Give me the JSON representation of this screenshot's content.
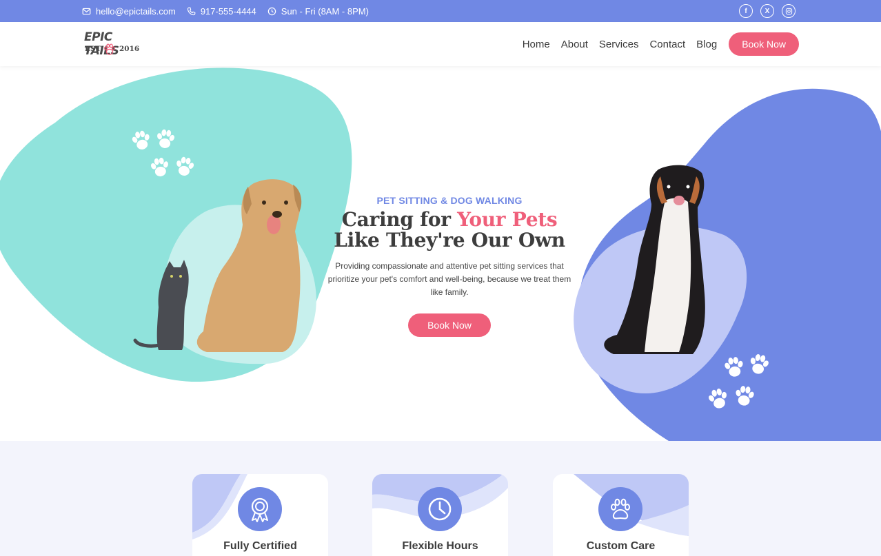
{
  "topbar": {
    "email": "hello@epictails.com",
    "phone": "917-555-4444",
    "hours": "Sun - Fri (8AM - 8PM)",
    "socials": [
      {
        "name": "facebook-icon",
        "glyph": "f"
      },
      {
        "name": "x-icon",
        "glyph": "X"
      },
      {
        "name": "instagram-icon",
        "glyph": ""
      }
    ]
  },
  "logo": {
    "line1": "EPIC TAILS",
    "est": "EST",
    "year": "2016"
  },
  "nav": {
    "items": [
      "Home",
      "About",
      "Services",
      "Contact",
      "Blog"
    ],
    "cta": "Book Now"
  },
  "hero": {
    "eyebrow": "PET SITTING & DOG WALKING",
    "headline_part1": "Caring for ",
    "headline_highlight": "Your Pets",
    "headline_line2": "Like They're Our Own",
    "lead": "Providing compassionate and attentive pet sitting services that prioritize your pet's comfort and well-being, because we treat them like family.",
    "cta": "Book Now"
  },
  "features": [
    {
      "title": "Fully Certified",
      "icon": "ribbon-badge-icon"
    },
    {
      "title": "Flexible Hours",
      "icon": "clock-icon"
    },
    {
      "title": "Custom Care",
      "icon": "paw-icon"
    }
  ],
  "colors": {
    "primary": "#7088e4",
    "accent": "#ef5f7a",
    "teal": "#90e3dc",
    "lavender": "#bfc8f6",
    "section_bg": "#f3f4fc"
  }
}
